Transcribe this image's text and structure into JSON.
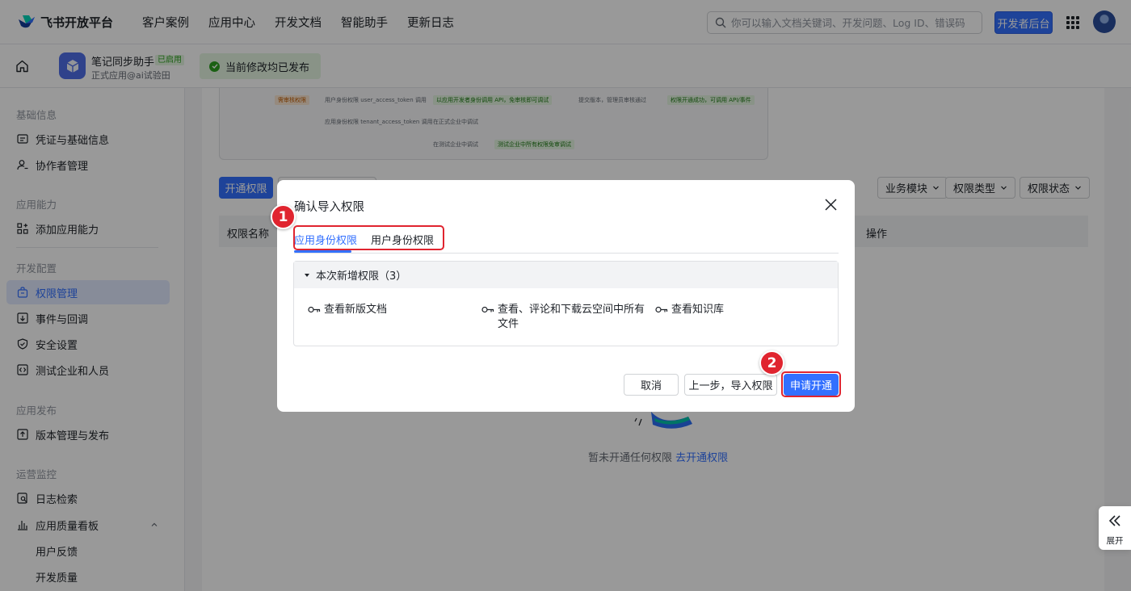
{
  "brand": {
    "name": "飞书开放平台",
    "logo_icon": "feishu-bird-icon"
  },
  "topnav": [
    "客户案例",
    "应用中心",
    "开发文档",
    "智能助手",
    "更新日志"
  ],
  "search": {
    "placeholder": "你可以输入文档关键词、开发问题、Log ID、错误码"
  },
  "dev_console_label": "开发者后台",
  "app": {
    "name": "笔记同步助手",
    "badge": "已启用",
    "subtitle": "正式应用@ai试验田"
  },
  "publish_status": "当前修改均已发布",
  "sidebar": {
    "sections": [
      "基础信息",
      "应用能力",
      "开发配置",
      "应用发布",
      "运营监控"
    ],
    "items": [
      {
        "label": "凭证与基础信息",
        "icon": "id-card-icon"
      },
      {
        "label": "协作者管理",
        "icon": "user-add-icon"
      },
      {
        "label": "添加应用能力",
        "icon": "grid-add-icon"
      },
      {
        "label": "权限管理",
        "icon": "lock-bag-icon",
        "active": true
      },
      {
        "label": "事件与回调",
        "icon": "event-icon"
      },
      {
        "label": "安全设置",
        "icon": "shield-icon"
      },
      {
        "label": "测试企业和人员",
        "icon": "test-code-icon"
      },
      {
        "label": "版本管理与发布",
        "icon": "upload-icon"
      },
      {
        "label": "日志检索",
        "icon": "log-search-icon"
      },
      {
        "label": "应用质量看板",
        "icon": "bar-chart-icon"
      },
      {
        "label": "用户反馈"
      },
      {
        "label": "开发质量"
      }
    ]
  },
  "flow": {
    "tag_review": "需审核权限",
    "row1_label": "用户身份权限 user_access_token 调用",
    "row1_step1": "以应用开发者身份调用 API，免审核即可调试",
    "row1_step2": "提交版本，管理员审核通过",
    "row1_step3": "权限开通成功，可调用 API/事件",
    "row2_label": "应用身份权限 tenant_access_token 调用",
    "row2_step1": "在正式企业中调试",
    "row3_step1": "在测试企业中调试",
    "row3_step2": "测试企业中所有权限免审调试"
  },
  "main": {
    "open_perm_btn": "开通权限",
    "filters": [
      "业务模块",
      "权限类型",
      "权限状态"
    ],
    "table_headers": [
      "权限名称",
      "操作"
    ],
    "empty_text": "暂未开通任何权限",
    "empty_link": "去开通权限"
  },
  "expand_label": "展开",
  "modal": {
    "title": "确认导入权限",
    "tabs": [
      "应用身份权限",
      "用户身份权限"
    ],
    "active_tab": 0,
    "group_title": "本次新增权限（3）",
    "permissions": [
      "查看新版文档",
      "查看、评论和下载云空间中所有文件",
      "查看知识库"
    ],
    "btn_cancel": "取消",
    "btn_prev": "上一步，导入权限",
    "btn_apply": "申请开通"
  },
  "annotations": {
    "step1": "1",
    "step2": "2",
    "color": "#e0242f"
  }
}
